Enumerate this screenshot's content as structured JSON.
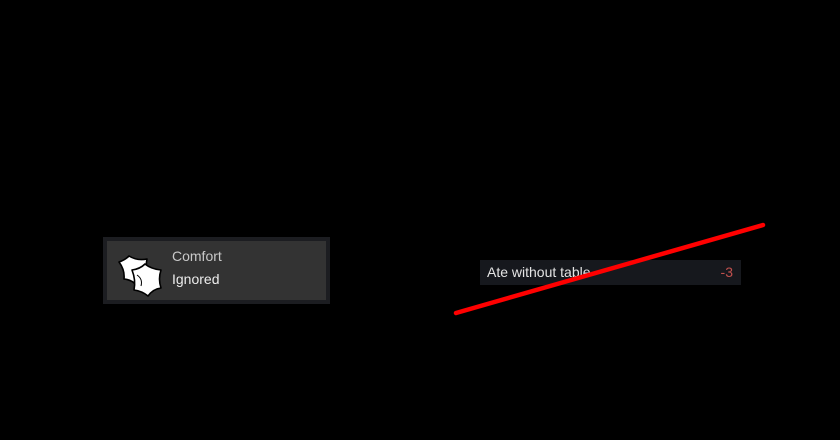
{
  "need": {
    "title": "Comfort",
    "status": "Ignored",
    "icon": "pillows-icon"
  },
  "thought": {
    "label": "Ate without table",
    "value": "-3",
    "value_color": "#c0504d"
  },
  "overlay": {
    "strike_color": "#ff0000"
  }
}
